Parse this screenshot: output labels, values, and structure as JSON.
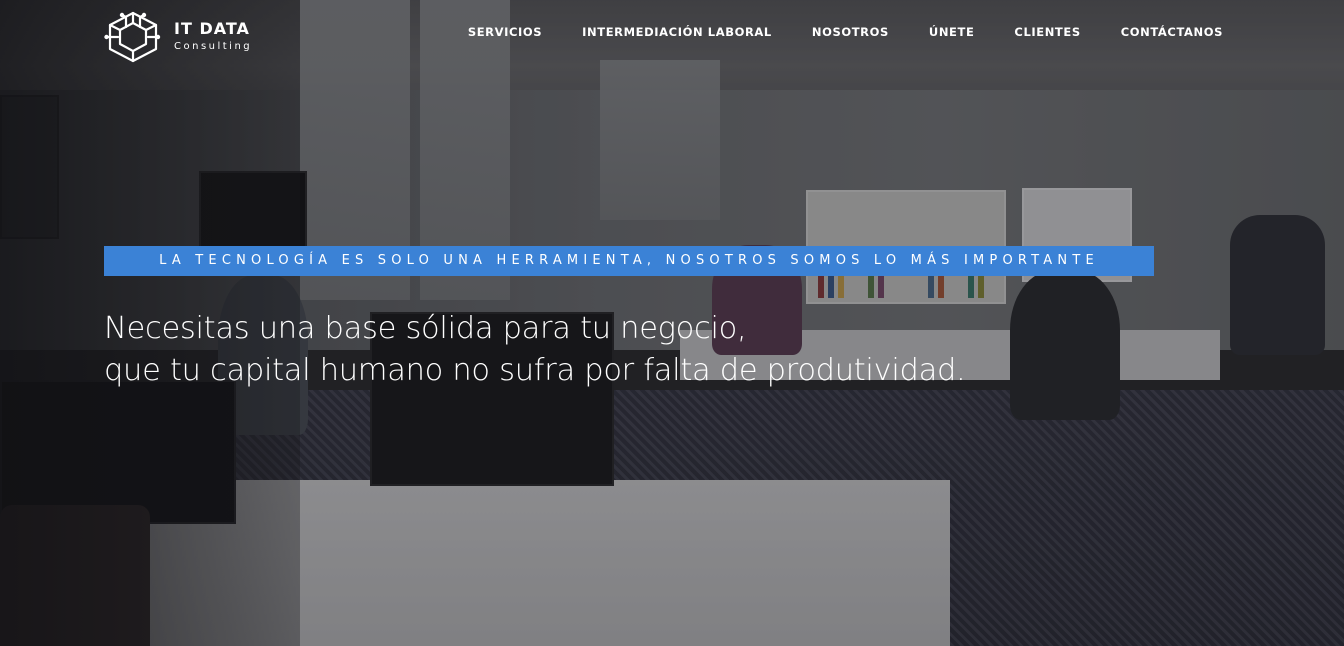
{
  "brand": {
    "title": "IT DATA",
    "subtitle": "Consulting",
    "logo_icon": "circuit-chip-icon"
  },
  "nav": {
    "items": [
      {
        "label": "SERVICIOS"
      },
      {
        "label": "INTERMEDIACIÓN LABORAL"
      },
      {
        "label": "NOSOTROS"
      },
      {
        "label": "ÚNETE"
      },
      {
        "label": "CLIENTES"
      },
      {
        "label": "CONTÁCTANOS"
      }
    ]
  },
  "hero": {
    "tagline": "LA TECNOLOGÍA ES SOLO UNA HERRAMIENTA, NOSOTROS SOMOS LO MÁS IMPORTANTE",
    "headline_line1": "Necesitas una base sólida para tu negocio,",
    "headline_line2": "que tu capital humano no sufra por falta de produtividad.",
    "accent_color": "#3b82d6",
    "background_image": "office-workspace-photo"
  }
}
